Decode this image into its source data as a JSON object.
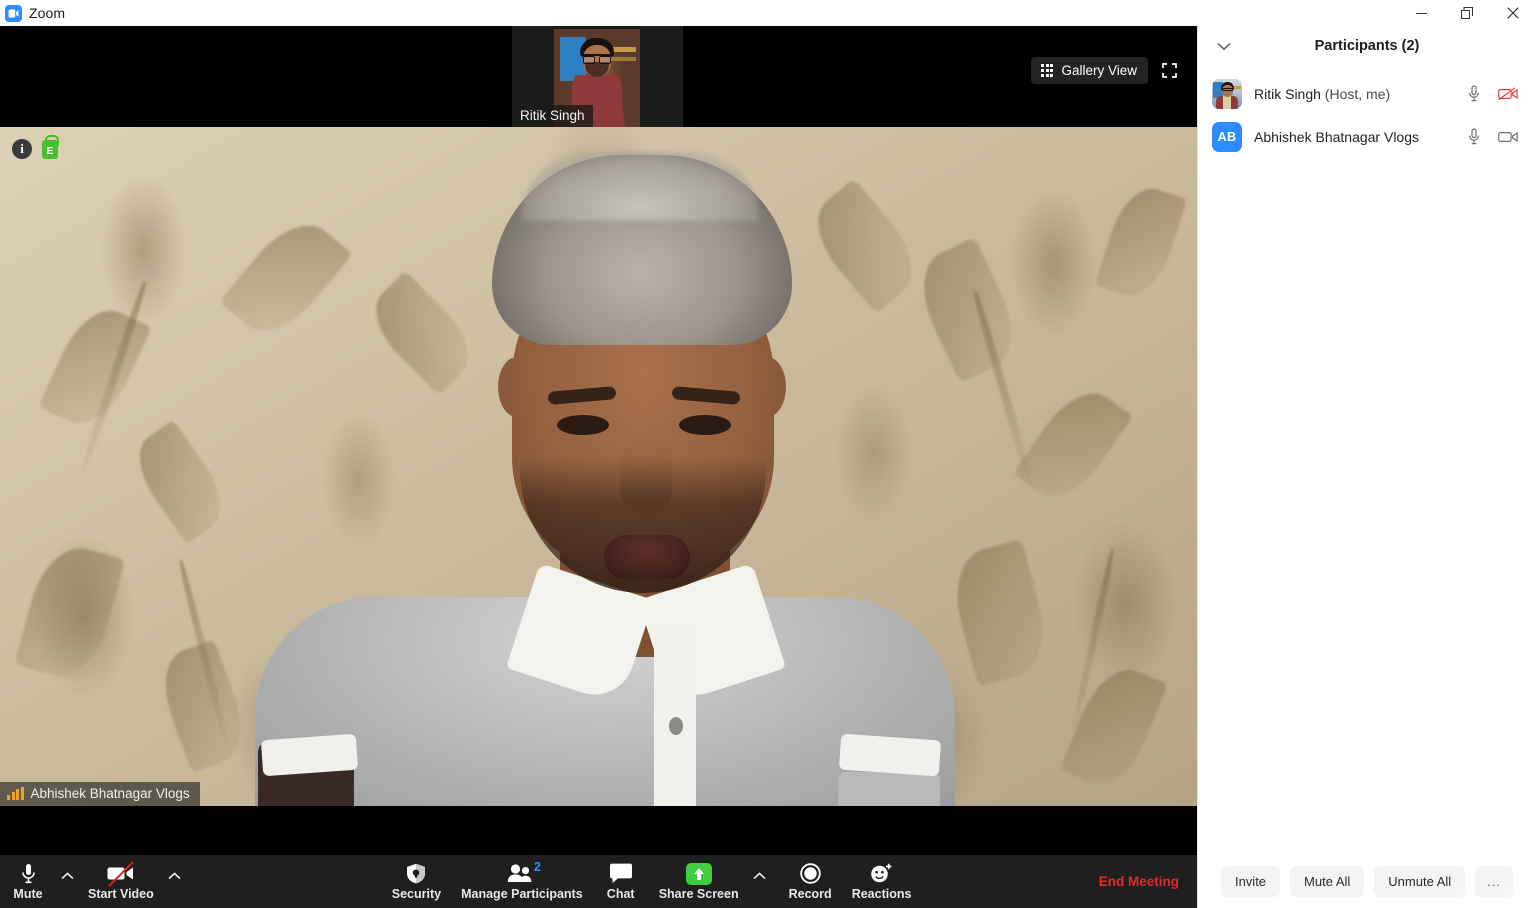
{
  "window": {
    "app_title": "Zoom",
    "logo_icon": "zoom-camera-icon",
    "minimize_icon": "minimize-icon",
    "maximize_icon": "maximize-icon",
    "close_icon": "close-icon"
  },
  "meeting": {
    "self_view": {
      "name": "Ritik Singh"
    },
    "view_controls": {
      "gallery_label": "Gallery View",
      "gallery_icon": "grid-icon",
      "fullscreen_icon": "fullscreen-icon"
    },
    "overlay": {
      "info_icon": "info-icon",
      "info_glyph": "i",
      "encryption_icon": "encryption-lock-icon",
      "encryption_glyph": "E"
    },
    "active_speaker": {
      "name": "Abhishek Bhatnagar Vlogs",
      "signal_icon": "signal-strength-icon"
    }
  },
  "toolbar": {
    "mute": {
      "label": "Mute",
      "icon": "microphone-icon",
      "has_caret": true
    },
    "video": {
      "label": "Start Video",
      "icon": "camera-off-icon",
      "has_caret": true
    },
    "security": {
      "label": "Security",
      "icon": "shield-icon"
    },
    "participants": {
      "label": "Manage Participants",
      "icon": "people-icon",
      "count": "2"
    },
    "chat": {
      "label": "Chat",
      "icon": "chat-bubble-icon"
    },
    "share": {
      "label": "Share Screen",
      "icon": "share-arrow-up-icon",
      "has_caret": true
    },
    "record": {
      "label": "Record",
      "icon": "record-circle-icon"
    },
    "reactions": {
      "label": "Reactions",
      "icon": "smiley-plus-icon"
    },
    "end": {
      "label": "End Meeting",
      "color": "#e32b2b"
    }
  },
  "participants_panel": {
    "title": "Participants (2)",
    "collapse_icon": "chevron-down-icon",
    "rows": [
      {
        "name": "Ritik Singh",
        "suffix": " (Host, me)",
        "avatar_type": "photo",
        "avatar_initials": "",
        "mic_icon": "microphone-icon",
        "mic_state": "on",
        "video_icon": "camera-off-icon",
        "video_state": "off"
      },
      {
        "name": "Abhishek Bhatnagar Vlogs",
        "suffix": "",
        "avatar_type": "initials",
        "avatar_initials": "AB",
        "mic_icon": "microphone-icon",
        "mic_state": "on",
        "video_icon": "camera-icon",
        "video_state": "on"
      }
    ],
    "footer": {
      "invite": "Invite",
      "mute_all": "Mute All",
      "unmute_all": "Unmute All",
      "more": "..."
    }
  },
  "colors": {
    "brand_blue": "#2D8CFF",
    "end_red": "#e32b2b",
    "share_green": "#3ece3e",
    "encryption_green": "#46c02c",
    "avatar_blue": "#2d8cff",
    "toolbar_bg": "#1f1f1f"
  }
}
